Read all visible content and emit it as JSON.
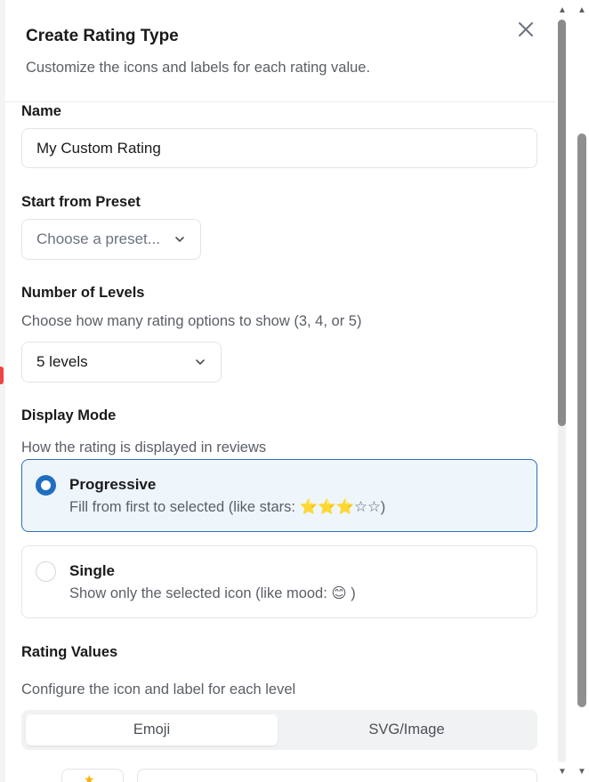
{
  "dialog": {
    "title": "Create Rating Type",
    "subtitle": "Customize the icons and labels for each rating value."
  },
  "name": {
    "label": "Name",
    "value": "My Custom Rating"
  },
  "preset": {
    "label": "Start from Preset",
    "placeholder": "Choose a preset..."
  },
  "levels": {
    "label": "Number of Levels",
    "help": "Choose how many rating options to show (3, 4, or 5)",
    "value": "5 levels"
  },
  "display_mode": {
    "label": "Display Mode",
    "help": "How the rating is displayed in reviews",
    "options": [
      {
        "title": "Progressive",
        "desc": "Fill from first to selected (like stars: ⭐⭐⭐☆☆)",
        "selected": true
      },
      {
        "title": "Single",
        "desc": "Show only the selected icon (like mood: 😊 )",
        "selected": false
      }
    ]
  },
  "rating_values": {
    "label": "Rating Values",
    "help": "Configure the icon and label for each level",
    "tabs": [
      "Emoji",
      "SVG/Image"
    ],
    "active_tab": "Emoji"
  },
  "colors": {
    "accent": "#1f6fc1",
    "selected_bg": "#eef5fb",
    "selected_border": "#2f6fb8"
  }
}
